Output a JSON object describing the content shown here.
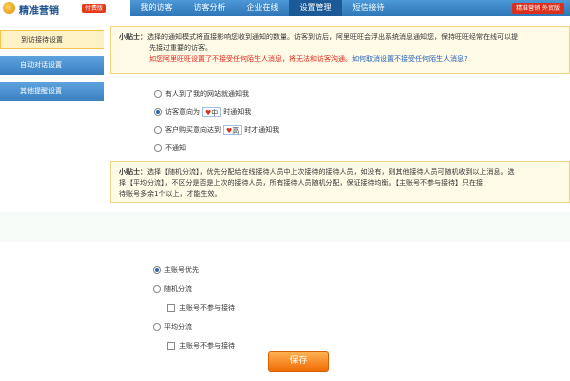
{
  "header": {
    "logo_text": "精准营销",
    "logo_badge": "付费版",
    "nav": [
      "我的访客",
      "访客分析",
      "企业在线",
      "设置管理",
      "短信接待"
    ],
    "active_nav": "设置管理",
    "right_badge": "精准营销 外贸版"
  },
  "sidebar": {
    "items": [
      {
        "label": "到访接待设置",
        "active": true
      },
      {
        "label": "自动对话设置",
        "active": false
      },
      {
        "label": "其他提醒设置",
        "active": false
      }
    ]
  },
  "tip1": {
    "title": "小贴士：",
    "line1": "选择的通知模式将直接影响您收到通知的数量。访客到访后，阿里旺旺会浮出系统消息通知您，保持旺旺经常在线可以提",
    "line2": "先接过重要的访客。",
    "warn_red": "如您阿里旺旺设置了不接受任何陌生人消息，将无法和访客沟通。",
    "warn_blue": "如何取消设置不接受任何陌生人消息?"
  },
  "notify_options": [
    {
      "label": "有人到了我的网站就通知我",
      "checked": false
    },
    {
      "label_before": "访客意向为",
      "label_box": "中",
      "label_after": "时通知我",
      "checked": true
    },
    {
      "label_before": "客户购买意向达到",
      "label_box": "高",
      "label_after": "时才通知我",
      "checked": false
    },
    {
      "label": "不通知",
      "checked": false
    }
  ],
  "tip2": {
    "title": "小贴士：",
    "line1": "选择【随机分流】，优先分配给在线接待人员中上次接待的接待人员，如没有，则其他接待人员可随机收到以上消息。选",
    "line2": "择【平均分流】，不区分是否是上次的接待人员，所有接待人员随机分配，保证接待均衡。【主账号不参与接待】只在接",
    "line3": "待账号多余1个以上，才能生效。"
  },
  "distribution": {
    "options": [
      {
        "label": "主账号优先",
        "checked": true
      },
      {
        "label": "随机分流",
        "checked": false,
        "sub": "主账号不参与接待"
      },
      {
        "label": "平均分流",
        "checked": false,
        "sub": "主账号不参与接待"
      }
    ]
  },
  "actions": {
    "save_label": "保存"
  }
}
